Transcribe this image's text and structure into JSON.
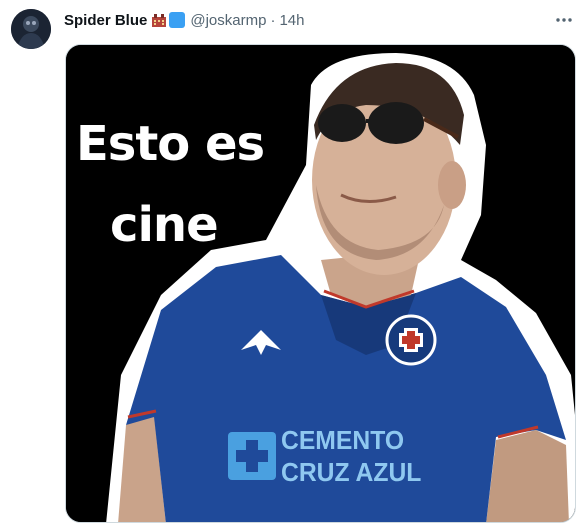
{
  "post": {
    "display_name": "Spider Blue",
    "handle": "@joskarmp",
    "separator": "·",
    "time": "14h",
    "badges": [
      "building-emoji",
      "blue-square-emoji"
    ]
  },
  "media": {
    "caption_lines": [
      "Esto es",
      "cine"
    ],
    "shirt_sponsor_line1": "CEMENTO",
    "shirt_sponsor_line2": "CRUZ AZUL"
  },
  "colors": {
    "handle_gray": "#536471",
    "shirt_blue": "#1f4a9a",
    "sticker_outline": "#ffffff"
  }
}
